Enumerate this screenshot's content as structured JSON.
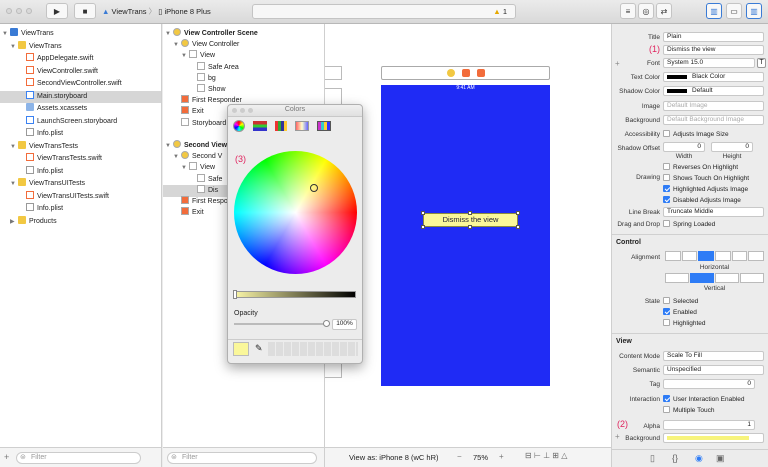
{
  "toolbar": {
    "scheme": "ViewTrans",
    "device": "iPhone 8 Plus",
    "warning_count": "1"
  },
  "navigator": {
    "items": [
      {
        "label": "ViewTrans",
        "icon": "project-icon",
        "indent": 0,
        "tri": "▼"
      },
      {
        "label": "ViewTrans",
        "icon": "folder-icon",
        "indent": 1,
        "tri": "▼"
      },
      {
        "label": "AppDelegate.swift",
        "icon": "swift-file-icon",
        "indent": 2
      },
      {
        "label": "ViewController.swift",
        "icon": "swift-file-icon",
        "indent": 2
      },
      {
        "label": "SecondViewController.swift",
        "icon": "swift-file-icon",
        "indent": 2
      },
      {
        "label": "Main.storyboard",
        "icon": "storyboard-icon",
        "indent": 2,
        "selected": true
      },
      {
        "label": "Assets.xcassets",
        "icon": "assets-icon",
        "indent": 2
      },
      {
        "label": "LaunchScreen.storyboard",
        "icon": "storyboard-icon",
        "indent": 2
      },
      {
        "label": "Info.plist",
        "icon": "plist-icon",
        "indent": 2
      },
      {
        "label": "ViewTransTests",
        "icon": "folder-icon",
        "indent": 1,
        "tri": "▼"
      },
      {
        "label": "ViewTransTests.swift",
        "icon": "swift-file-icon",
        "indent": 2
      },
      {
        "label": "Info.plist",
        "icon": "plist-icon",
        "indent": 2
      },
      {
        "label": "ViewTransUITests",
        "icon": "folder-icon",
        "indent": 1,
        "tri": "▼"
      },
      {
        "label": "ViewTransUITests.swift",
        "icon": "swift-file-icon",
        "indent": 2
      },
      {
        "label": "Info.plist",
        "icon": "plist-icon",
        "indent": 2
      },
      {
        "label": "Products",
        "icon": "folder-icon",
        "indent": 1,
        "tri": "▶"
      }
    ],
    "filter_placeholder": "Filter"
  },
  "outline": {
    "items": [
      {
        "label": "View Controller Scene",
        "indent": 0,
        "bold": true,
        "tri": "▼",
        "icon": "scene"
      },
      {
        "label": "View Controller",
        "indent": 1,
        "tri": "▼",
        "icon": "vc"
      },
      {
        "label": "View",
        "indent": 2,
        "tri": "▼",
        "icon": "view"
      },
      {
        "label": "Safe Area",
        "indent": 3,
        "icon": "view"
      },
      {
        "label": "bg",
        "indent": 3,
        "icon": "view"
      },
      {
        "label": "Show",
        "indent": 3,
        "icon": "btn"
      },
      {
        "label": "First Responder",
        "indent": 1,
        "icon": "fr"
      },
      {
        "label": "Exit",
        "indent": 1,
        "icon": "exit"
      },
      {
        "label": "Storyboard",
        "indent": 1,
        "icon": "seg"
      },
      {
        "label": "",
        "indent": 0
      },
      {
        "label": "Second View",
        "indent": 0,
        "bold": true,
        "tri": "▼",
        "icon": "scene"
      },
      {
        "label": "Second V",
        "indent": 1,
        "tri": "▼",
        "icon": "vc"
      },
      {
        "label": "View",
        "indent": 2,
        "tri": "▼",
        "icon": "view"
      },
      {
        "label": "Safe",
        "indent": 3,
        "icon": "view"
      },
      {
        "label": "Dis",
        "indent": 3,
        "icon": "btn",
        "selected": true
      },
      {
        "label": "First Responder",
        "indent": 1,
        "icon": "fr"
      },
      {
        "label": "Exit",
        "indent": 1,
        "icon": "exit"
      }
    ],
    "filter_placeholder": "Filter"
  },
  "canvas": {
    "button_title": "Dismiss the view",
    "status_time": "9:41 AM",
    "view_as": "View as: iPhone 8 (wC hR)",
    "zoom": "75%",
    "bg_color": "#1f2bf5",
    "button_color": "#faf79a"
  },
  "colors_panel": {
    "title": "Colors",
    "opacity_label": "Opacity",
    "opacity_value": "100%",
    "annotation": "(3)"
  },
  "inspector": {
    "title_style": "Plain",
    "title_value": "Dismiss the view",
    "font": "System 15.0",
    "text_color": "Black Color",
    "shadow_color": "Default",
    "image_placeholder": "Default Image",
    "background_placeholder": "Default Background Image",
    "labels": {
      "title": "Title",
      "font": "Font",
      "text_color": "Text Color",
      "shadow_color": "Shadow Color",
      "image": "Image",
      "background": "Background",
      "accessibility": "Accessibility",
      "shadow_offset": "Shadow Offset",
      "width": "Width",
      "height": "Height",
      "drawing": "Drawing",
      "line_break": "Line Break",
      "drag_drop": "Drag and Drop",
      "alignment": "Alignment",
      "horizontal": "Horizontal",
      "vertical": "Vertical",
      "state": "State",
      "content_mode": "Content Mode",
      "semantic": "Semantic",
      "tag": "Tag",
      "interaction": "Interaction",
      "alpha": "Alpha",
      "background2": "Background",
      "control": "Control",
      "view": "View"
    },
    "checks": {
      "adjusts_image_size": "Adjusts Image Size",
      "reverses": "Reverses On Highlight",
      "shows_touch": "Shows Touch On Highlight",
      "highlighted_adjusts": "Highlighted Adjusts Image",
      "disabled_adjusts": "Disabled Adjusts Image",
      "spring_loaded": "Spring Loaded",
      "selected": "Selected",
      "enabled": "Enabled",
      "highlighted": "Highlighted",
      "user_interaction": "User Interaction Enabled",
      "multiple_touch": "Multiple Touch"
    },
    "shadow_w": "0",
    "shadow_h": "0",
    "line_break_value": "Truncate Middle",
    "content_mode_value": "Scale To Fill",
    "semantic_value": "Unspecified",
    "tag_value": "0",
    "alpha_value": "1",
    "annotation1": "(1)",
    "annotation2": "(2)",
    "background_swatch": "#f7f47c"
  }
}
